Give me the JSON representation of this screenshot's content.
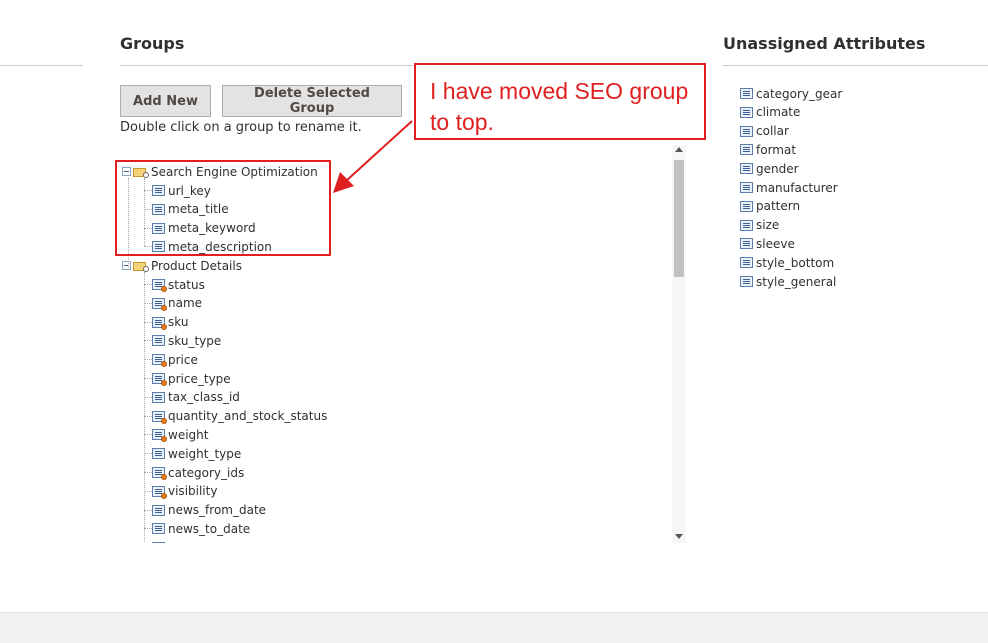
{
  "groups": {
    "title": "Groups",
    "add_new_label": "Add New",
    "delete_label": "Delete Selected Group",
    "hint": "Double click on a group to rename it."
  },
  "tree": {
    "seo_group": {
      "label": "Search Engine Optimization",
      "items": [
        "url_key",
        "meta_title",
        "meta_keyword",
        "meta_description"
      ]
    },
    "product_group": {
      "label": "Product Details",
      "items": [
        {
          "label": "status",
          "user": true
        },
        {
          "label": "name",
          "user": true
        },
        {
          "label": "sku",
          "user": true
        },
        {
          "label": "sku_type",
          "user": false
        },
        {
          "label": "price",
          "user": true
        },
        {
          "label": "price_type",
          "user": true
        },
        {
          "label": "tax_class_id",
          "user": false
        },
        {
          "label": "quantity_and_stock_status",
          "user": true
        },
        {
          "label": "weight",
          "user": true
        },
        {
          "label": "weight_type",
          "user": false
        },
        {
          "label": "category_ids",
          "user": true
        },
        {
          "label": "visibility",
          "user": true
        },
        {
          "label": "news_from_date",
          "user": false
        },
        {
          "label": "news_to_date",
          "user": false
        }
      ]
    }
  },
  "annotation": {
    "text": "I have moved SEO group to top.",
    "color": "#e02020"
  },
  "unassigned": {
    "title": "Unassigned Attributes",
    "items": [
      "category_gear",
      "climate",
      "collar",
      "format",
      "gender",
      "manufacturer",
      "pattern",
      "size",
      "sleeve",
      "style_bottom",
      "style_general"
    ]
  }
}
